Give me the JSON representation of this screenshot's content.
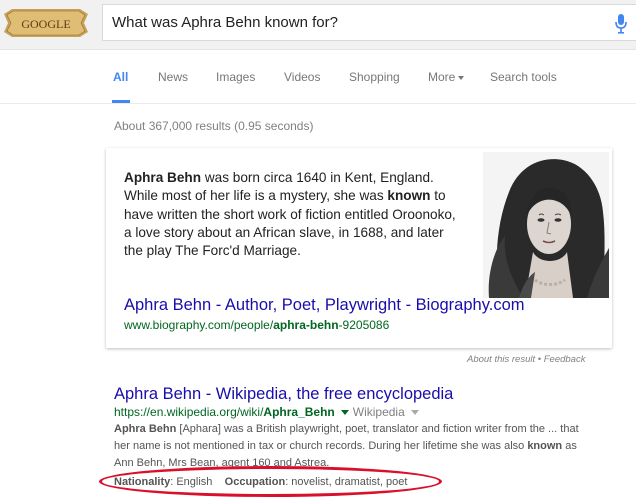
{
  "header": {
    "logo_text": "GOOGLE",
    "query": "What was Aphra Behn known for?"
  },
  "tabs": [
    {
      "label": "All"
    },
    {
      "label": "News"
    },
    {
      "label": "Images"
    },
    {
      "label": "Videos"
    },
    {
      "label": "Shopping"
    },
    {
      "label": "More"
    },
    {
      "label": "Search tools"
    }
  ],
  "stats": "About 367,000 results (0.95 seconds)",
  "answer": {
    "p1_bold": "Aphra Behn",
    "p1": " was born circa 1640 in Kent, England. While most of her life is a mystery, she was ",
    "p2_bold": "known",
    "p2": " to have written the short work of fiction entitled Oroonoko, a love story about an African slave, in 1688, and later the play The Forc'd Marriage.",
    "title": "Aphra Behn - Author, Poet, Playwright - Biography.com",
    "url_pre": "www.biography.com/people/",
    "url_bold": "aphra-behn",
    "url_post": "-9205086"
  },
  "about": {
    "about_label": "About this result",
    "sep": " • ",
    "feedback_label": "Feedback"
  },
  "result": {
    "title": "Aphra Behn - Wikipedia, the free encyclopedia",
    "url_pre": "https://en.wikipedia.org/wiki/",
    "url_bold": "Aphra_Behn",
    "url_sub": "Wikipedia",
    "snippet_b1": "Aphra Behn",
    "snippet_1": " [Aphara] was a British playwright, poet, translator and fiction writer from the ... that her name is not mentioned in tax or church records. During her lifetime she was also ",
    "snippet_b2": "known",
    "snippet_2": " as Ann Behn, Mrs Bean, agent 160 and Astrea.",
    "fact1_label": "Nationality",
    "fact1_value": ": English",
    "fact2_label": "Occupation",
    "fact2_value": ": novelist, dramatist, poet"
  },
  "colors": {
    "link": "#1a0dab",
    "url": "#006621",
    "tab_active": "#4285f4",
    "highlight": "#d9102b"
  }
}
